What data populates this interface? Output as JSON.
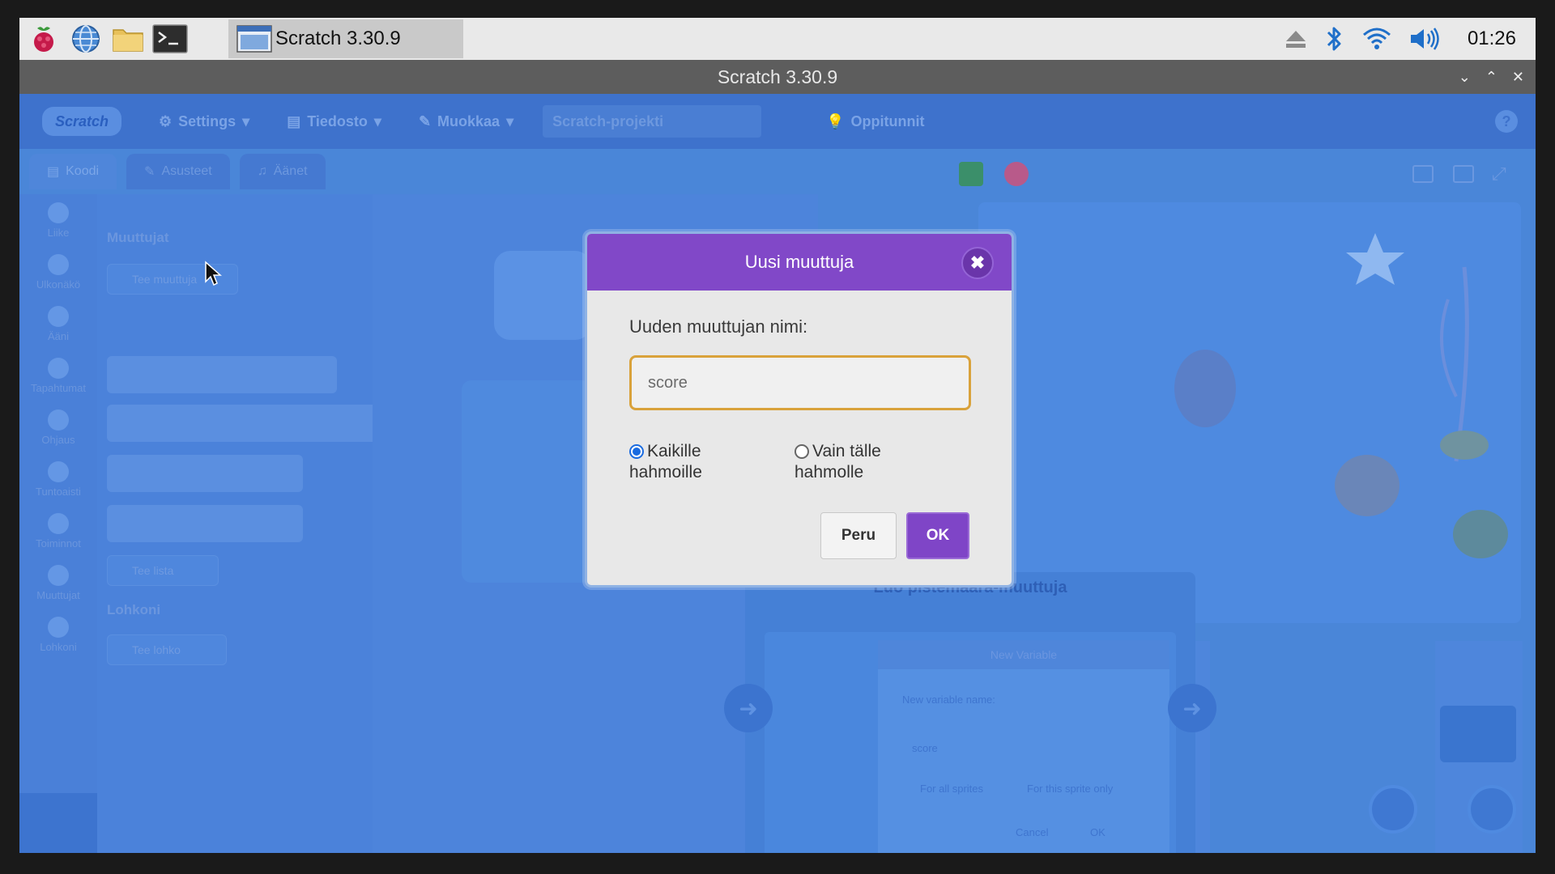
{
  "taskbar": {
    "task_label": "Scratch 3.30.9",
    "clock": "01:26",
    "icons": [
      "raspberry-icon",
      "browser-globe-icon",
      "folder-icon",
      "terminal-icon"
    ],
    "tray_icons": [
      "eject-icon",
      "bluetooth-icon",
      "wifi-icon",
      "volume-icon"
    ]
  },
  "window": {
    "title": "Scratch 3.30.9"
  },
  "menubar": {
    "logo": "Scratch",
    "settings": "Settings",
    "file": "Tiedosto",
    "edit": "Muokkaa",
    "project_name": "Scratch-projekti",
    "tutorials": "Oppitunnit",
    "help": "?"
  },
  "tabs": [
    {
      "label": "Koodi"
    },
    {
      "label": "Asusteet"
    },
    {
      "label": "Äänet"
    }
  ],
  "categories": [
    "Liike",
    "Ulkonäkö",
    "Ääni",
    "Tapahtumat",
    "Ohjaus",
    "Tuntoaisti",
    "Toiminnot",
    "Muuttujat",
    "Lohkoni"
  ],
  "palette": {
    "variables_heading": "Muuttujat",
    "make_variable": "Tee muuttuja",
    "make_list": "Tee lista",
    "blocks_heading": "Lohkoni",
    "make_block": "Tee lohko"
  },
  "tutorial": {
    "title": "Luo pistemäärä-muuttuja",
    "modal_title": "New Variable",
    "name_label": "New variable name:",
    "input_value": "score",
    "opt_all": "For all sprites",
    "opt_this": "For this sprite only",
    "cancel": "Cancel",
    "ok": "OK"
  },
  "dialog": {
    "title": "Uusi muuttuja",
    "name_label": "Uuden muuttujan nimi:",
    "input_value": "score",
    "option_all_line1": "Kaikille",
    "option_all_line2": "hahmoille",
    "option_this_line1": "Vain tälle",
    "option_this_line2": "hahmolle",
    "selected_option": "all",
    "cancel_label": "Peru",
    "ok_label": "OK",
    "accent_color": "#8148c8"
  }
}
